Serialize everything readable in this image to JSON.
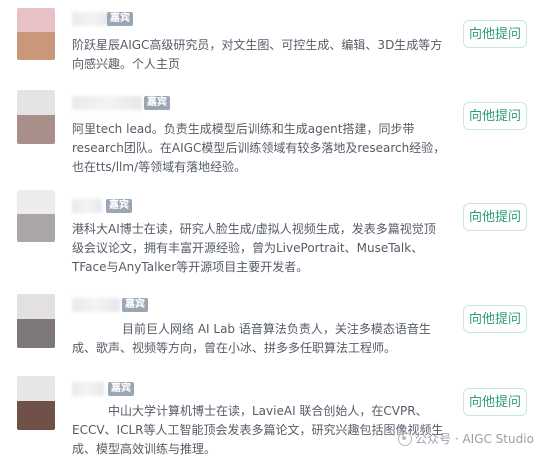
{
  "experts": [
    {
      "badge": "嘉宾",
      "description": "阶跃星辰AIGC高级研究员，对文生图、可控生成、编辑、3D生成等方向感兴趣。个人主页",
      "button": "向他提问"
    },
    {
      "badge": "嘉宾",
      "description": "阿里tech lead。负责生成模型后训练和生成agent搭建，同步带research团队。在AIGC模型后训练领域有较多落地及research经验，也在tts/llm/等领域有落地经验。",
      "button": "向他提问"
    },
    {
      "badge": "嘉宾",
      "description": "港科大AI博士在读，研究人脸生成/虚拟人视频生成，发表多篇视觉顶级会议论文，拥有丰富开源经验，曾为LivePortrait、MuseTalk、TFace与AnyTalker等开源项目主要开发者。",
      "button": "向他提问"
    },
    {
      "badge": "嘉宾",
      "description": "目前巨人网络 AI Lab 语音算法负责人，关注多模态语音生成、歌声、视频等方向，曾在小冰、拼多多任职算法工程师。",
      "button": "向他提问"
    },
    {
      "badge": "嘉宾",
      "description": "中山大学计算机博士在读，LavieAI 联合创始人，在CVPR、ECCV、ICLR等人工智能顶会发表多篇论文，研究兴趣包括图像视频生成、模型高效训练与推理。",
      "button": "向他提问"
    }
  ],
  "watermark": "公众号 · AIGC Studio",
  "colors": {
    "button_text": "#2f9b74",
    "button_border": "#c9e7db",
    "badge_bg": "#9aa6b4",
    "desc_text": "#555c66"
  }
}
